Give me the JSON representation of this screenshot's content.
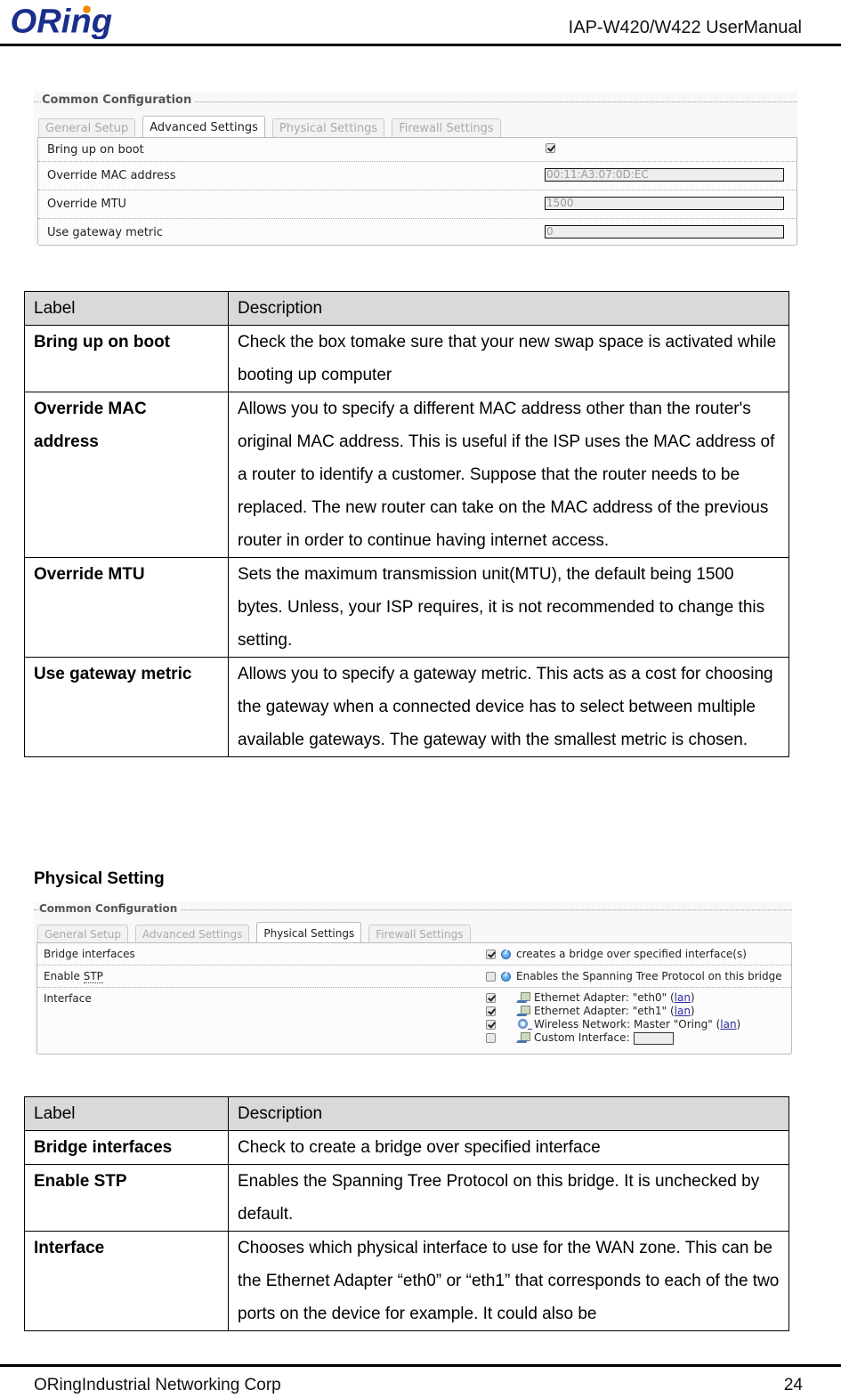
{
  "header": {
    "logo_text": "ORing",
    "title": "IAP-W420/W422  UserManual",
    "brand_color": "#1a2f8a",
    "accent_color": "#f08a00"
  },
  "advanced_panel": {
    "legend": "Common Configuration",
    "tabs": [
      {
        "label": "General Setup",
        "active": false
      },
      {
        "label": "Advanced Settings",
        "active": true
      },
      {
        "label": "Physical Settings",
        "active": false
      },
      {
        "label": "Firewall Settings",
        "active": false
      }
    ],
    "rows": [
      {
        "label": "Bring up on boot",
        "type": "checkbox",
        "checked": true
      },
      {
        "label": "Override MAC address",
        "type": "text",
        "value": "00:11:A3:07:0D:EC"
      },
      {
        "label": "Override MTU",
        "type": "text",
        "value": "1500"
      },
      {
        "label": "Use gateway metric",
        "type": "text",
        "value": "0"
      }
    ]
  },
  "advanced_table": {
    "headers": [
      "Label",
      "Description"
    ],
    "rows": [
      {
        "label": "Bring up on boot",
        "description": "Check the box tomake sure that your new swap space is activated while booting up computer"
      },
      {
        "label": "Override MAC address",
        "description": "Allows you to specify a different MAC address other than the router's original MAC address. This is useful if the ISP uses the MAC address of a router to identify a customer. Suppose that the router needs to be replaced. The new router can take on the MAC address of the previous router in order to continue having internet access."
      },
      {
        "label": "Override MTU",
        "description": "Sets the maximum transmission unit(MTU), the default being 1500 bytes. Unless, your ISP requires, it is not recommended to change this setting."
      },
      {
        "label": "Use gateway metric",
        "description": "Allows you to specify a gateway metric. This acts as a cost for choosing the gateway when a connected device has to select between multiple available gateways. The gateway with the smallest metric is chosen."
      }
    ]
  },
  "physical_heading": "Physical Setting",
  "physical_panel": {
    "legend": "Common Configuration",
    "tabs": [
      {
        "label": "General Setup",
        "active": false
      },
      {
        "label": "Advanced Settings",
        "active": false
      },
      {
        "label": "Physical Settings",
        "active": true
      },
      {
        "label": "Firewall Settings",
        "active": false
      }
    ],
    "bridge": {
      "label": "Bridge interfaces",
      "checked": true,
      "help": "creates a bridge over specified interface(s)"
    },
    "stp": {
      "label_prefix": "Enable ",
      "label_abbr": "STP",
      "checked": false,
      "help": "Enables the Spanning Tree Protocol on this bridge"
    },
    "interface": {
      "label": "Interface",
      "options": [
        {
          "icon": "ethernet-adapter-icon",
          "text": "Ethernet Adapter: \"eth0\" (",
          "link": "lan",
          "close": ")",
          "checked": true
        },
        {
          "icon": "ethernet-adapter-icon",
          "text": "Ethernet Adapter: \"eth1\" (",
          "link": "lan",
          "close": ")",
          "checked": true
        },
        {
          "icon": "wireless-network-icon",
          "text": "Wireless Network: Master \"Oring\" (",
          "link": "lan",
          "close": ")",
          "checked": true
        },
        {
          "icon": "ethernet-adapter-icon",
          "text": "Custom Interface:",
          "link": "",
          "close": "",
          "checked": false
        }
      ]
    }
  },
  "physical_table": {
    "headers": [
      "Label",
      "Description"
    ],
    "rows": [
      {
        "label": "Bridge interfaces",
        "description": "Check to create a bridge over specified interface"
      },
      {
        "label": "Enable STP",
        "description": "Enables the Spanning Tree Protocol on this bridge. It is unchecked by default."
      },
      {
        "label": "Interface",
        "description": "Chooses which physical interface to use for the WAN zone. This can be the Ethernet Adapter  “eth0” or “eth1” that corresponds to each of the two ports on the device for example. It could also be"
      }
    ]
  },
  "footer": {
    "company": "ORingIndustrial Networking Corp",
    "page_number": "24"
  }
}
